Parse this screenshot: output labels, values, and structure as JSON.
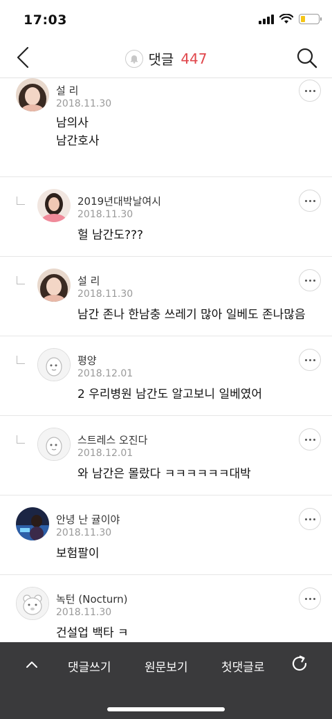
{
  "status": {
    "time": "17:03"
  },
  "nav": {
    "title": "댓글",
    "count": "447"
  },
  "comments": [
    {
      "author": "설 리",
      "date": "2018.11.30",
      "lines": [
        "남의사",
        "남간호사"
      ],
      "reply": false
    },
    {
      "author": "2019년대박날여시",
      "date": "2018.11.30",
      "lines": [
        "헐 남간도???"
      ],
      "reply": true
    },
    {
      "author": "설 리",
      "date": "2018.11.30",
      "lines": [
        "남간 존나 한남충 쓰레기 많아 일베도 존나많음"
      ],
      "reply": true
    },
    {
      "author": "평양",
      "date": "2018.12.01",
      "lines": [
        "2 우리병원 남간도 알고보니 일베였어"
      ],
      "reply": true
    },
    {
      "author": "스트레스 오진다",
      "date": "2018.12.01",
      "lines": [
        "와 남간은 몰랐다 ㅋㅋㅋㅋㅋㅋ대박"
      ],
      "reply": true
    },
    {
      "author": "안녕 난 귤이야",
      "date": "2018.11.30",
      "lines": [
        "보험팔이"
      ],
      "reply": false
    },
    {
      "author": "녹턴 (Nocturn)",
      "date": "2018.11.30",
      "lines": [
        "건설업 백타 ㅋ"
      ],
      "reply": false
    }
  ],
  "bottom": {
    "write": "댓글쓰기",
    "original": "원문보기",
    "first": "첫댓글로"
  }
}
